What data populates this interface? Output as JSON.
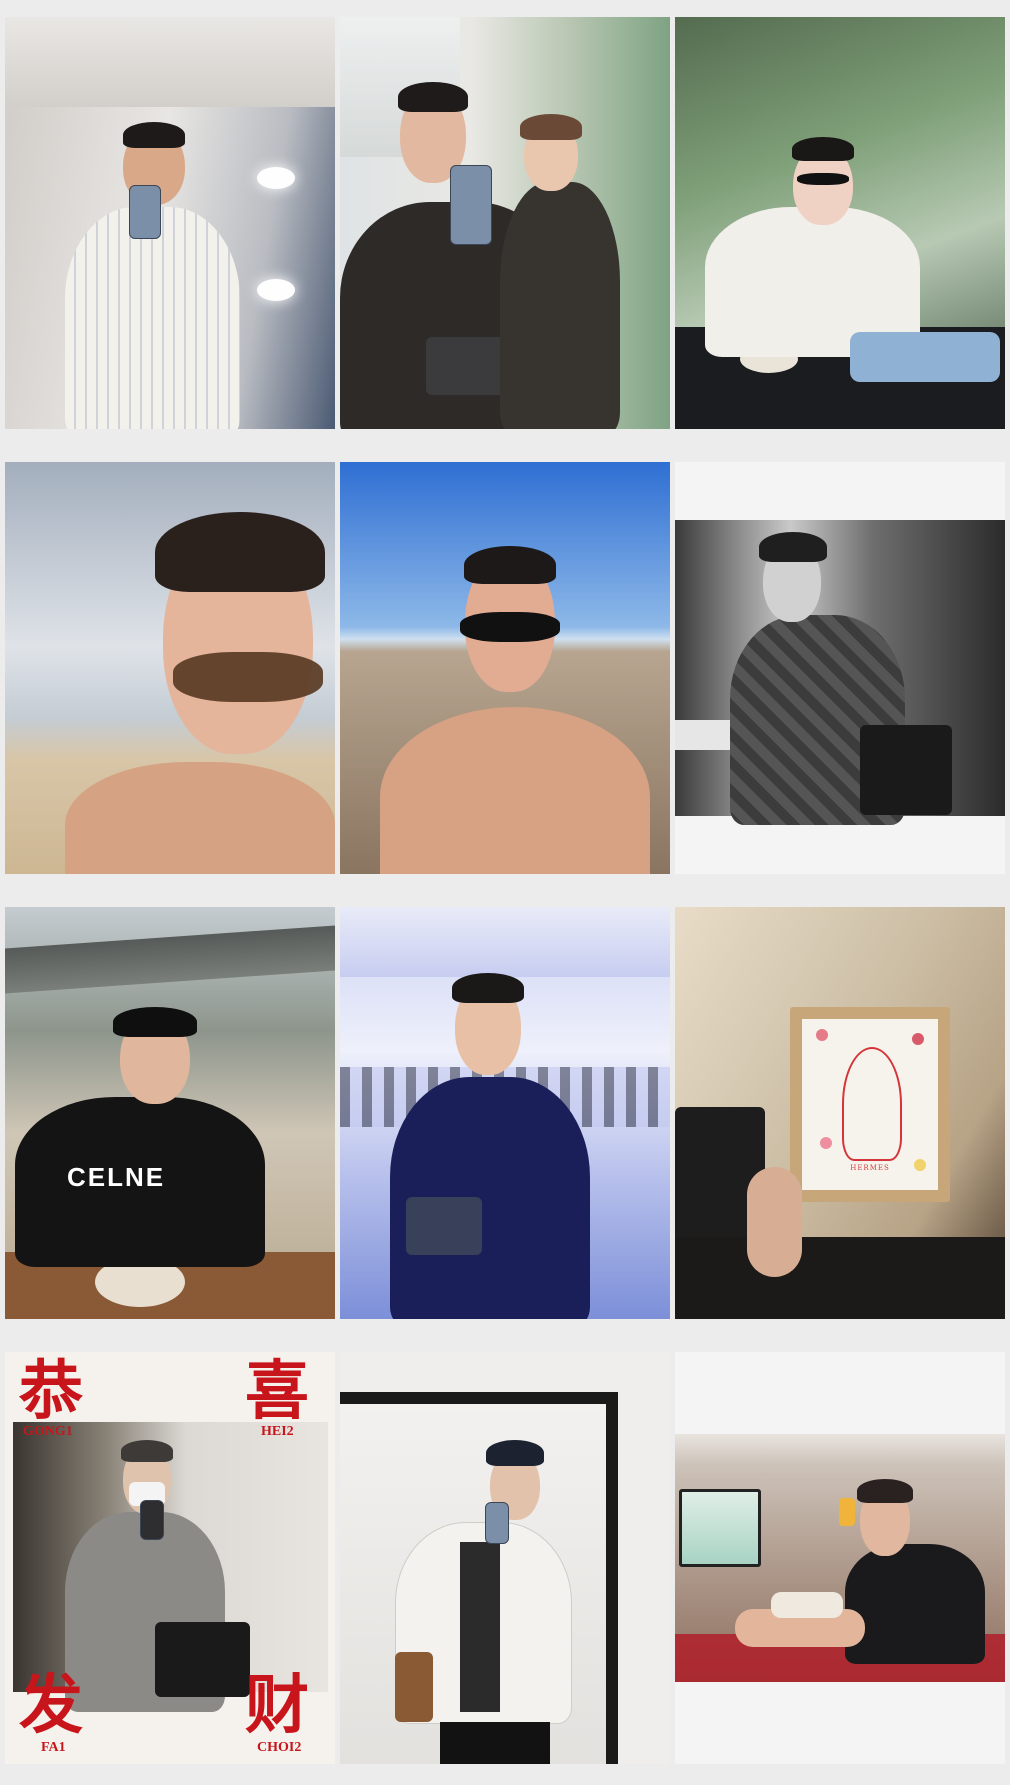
{
  "grid": {
    "columns": 3,
    "rows": 4,
    "background": "#ececec"
  },
  "tiles": [
    {
      "id": "airplane-lavatory-mirror-selfie",
      "bg": "#d9d6d2"
    },
    {
      "id": "mirror-selfie-with-friend",
      "bg": "#c9cfd4"
    },
    {
      "id": "cafe-white-sweater",
      "bg": "#8ba38a"
    },
    {
      "id": "beach-sunglasses-cloudy",
      "bg": "#bfc7d1"
    },
    {
      "id": "beach-sunglasses-clear-sky",
      "bg": "#3f7fcf"
    },
    {
      "id": "black-and-white-portrait-with-bag",
      "bg": "#9a9a9a"
    },
    {
      "id": "restaurant-celine-shirt",
      "bg": "#c7cdc6",
      "shirt_text": "CELNE"
    },
    {
      "id": "event-hall-navy-shirt",
      "bg": "#c9cfee"
    },
    {
      "id": "framed-portrait-sketch",
      "bg": "#d8cdb8",
      "frame_mark": "HERMES"
    },
    {
      "id": "new-year-greeting-selfie",
      "bg": "#f5f2ee",
      "greeting": {
        "top_left": {
          "char": "恭",
          "roman": "GONG1"
        },
        "top_right": {
          "char": "喜",
          "roman": "HEI2"
        },
        "bottom_left": {
          "char": "发",
          "roman": "FA1"
        },
        "bottom_right": {
          "char": "财",
          "roman": "CHOI2"
        }
      },
      "accent": "#c8151b"
    },
    {
      "id": "white-shirt-mirror-selfie",
      "bg": "#efeeec"
    },
    {
      "id": "airplane-cabin-toast",
      "bg": "#9b8d84"
    }
  ]
}
